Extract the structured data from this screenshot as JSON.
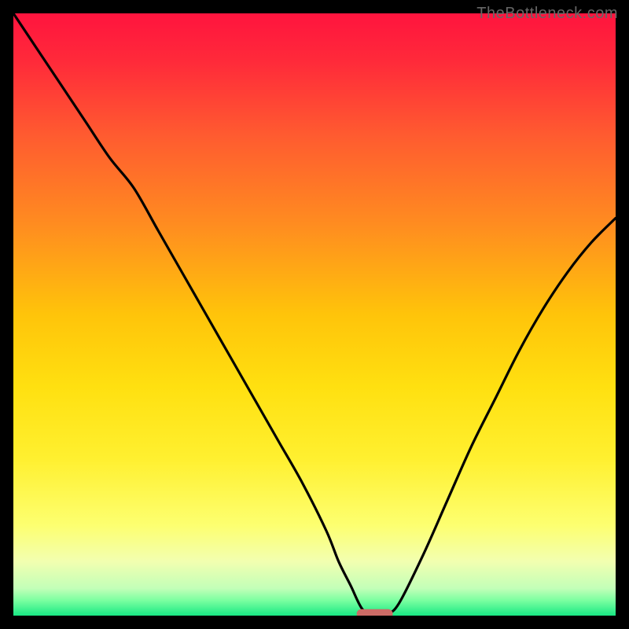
{
  "watermark": "TheBottleneck.com",
  "colors": {
    "frame_border": "#000000",
    "curve_stroke": "#000000",
    "marker_fill": "#cc6b66",
    "gradient_stops": [
      {
        "offset": 0.0,
        "color": "#ff143e"
      },
      {
        "offset": 0.08,
        "color": "#ff2a3a"
      },
      {
        "offset": 0.2,
        "color": "#ff5a30"
      },
      {
        "offset": 0.35,
        "color": "#ff8c20"
      },
      {
        "offset": 0.5,
        "color": "#ffc40a"
      },
      {
        "offset": 0.62,
        "color": "#ffe010"
      },
      {
        "offset": 0.74,
        "color": "#fff030"
      },
      {
        "offset": 0.85,
        "color": "#fdff70"
      },
      {
        "offset": 0.91,
        "color": "#f2ffb0"
      },
      {
        "offset": 0.955,
        "color": "#c2ffb8"
      },
      {
        "offset": 0.975,
        "color": "#7affa0"
      },
      {
        "offset": 1.0,
        "color": "#18e884"
      }
    ]
  },
  "chart_data": {
    "type": "line",
    "title": "",
    "xlabel": "",
    "ylabel": "",
    "xlim": [
      0,
      100
    ],
    "ylim": [
      0,
      100
    ],
    "x": [
      0,
      4,
      8,
      12,
      16,
      20,
      24,
      28,
      32,
      36,
      40,
      44,
      48,
      52,
      54,
      56,
      58,
      60,
      62,
      64,
      68,
      72,
      76,
      80,
      84,
      88,
      92,
      96,
      100
    ],
    "values": [
      100,
      94,
      88,
      82,
      76,
      71,
      64,
      57,
      50,
      43,
      36,
      29,
      22,
      14,
      9,
      5,
      1,
      0.3,
      0.3,
      2,
      10,
      19,
      28,
      36,
      44,
      51,
      57,
      62,
      66
    ],
    "optimal_marker": {
      "x_start": 57,
      "x_end": 63,
      "y": 0.3
    }
  }
}
